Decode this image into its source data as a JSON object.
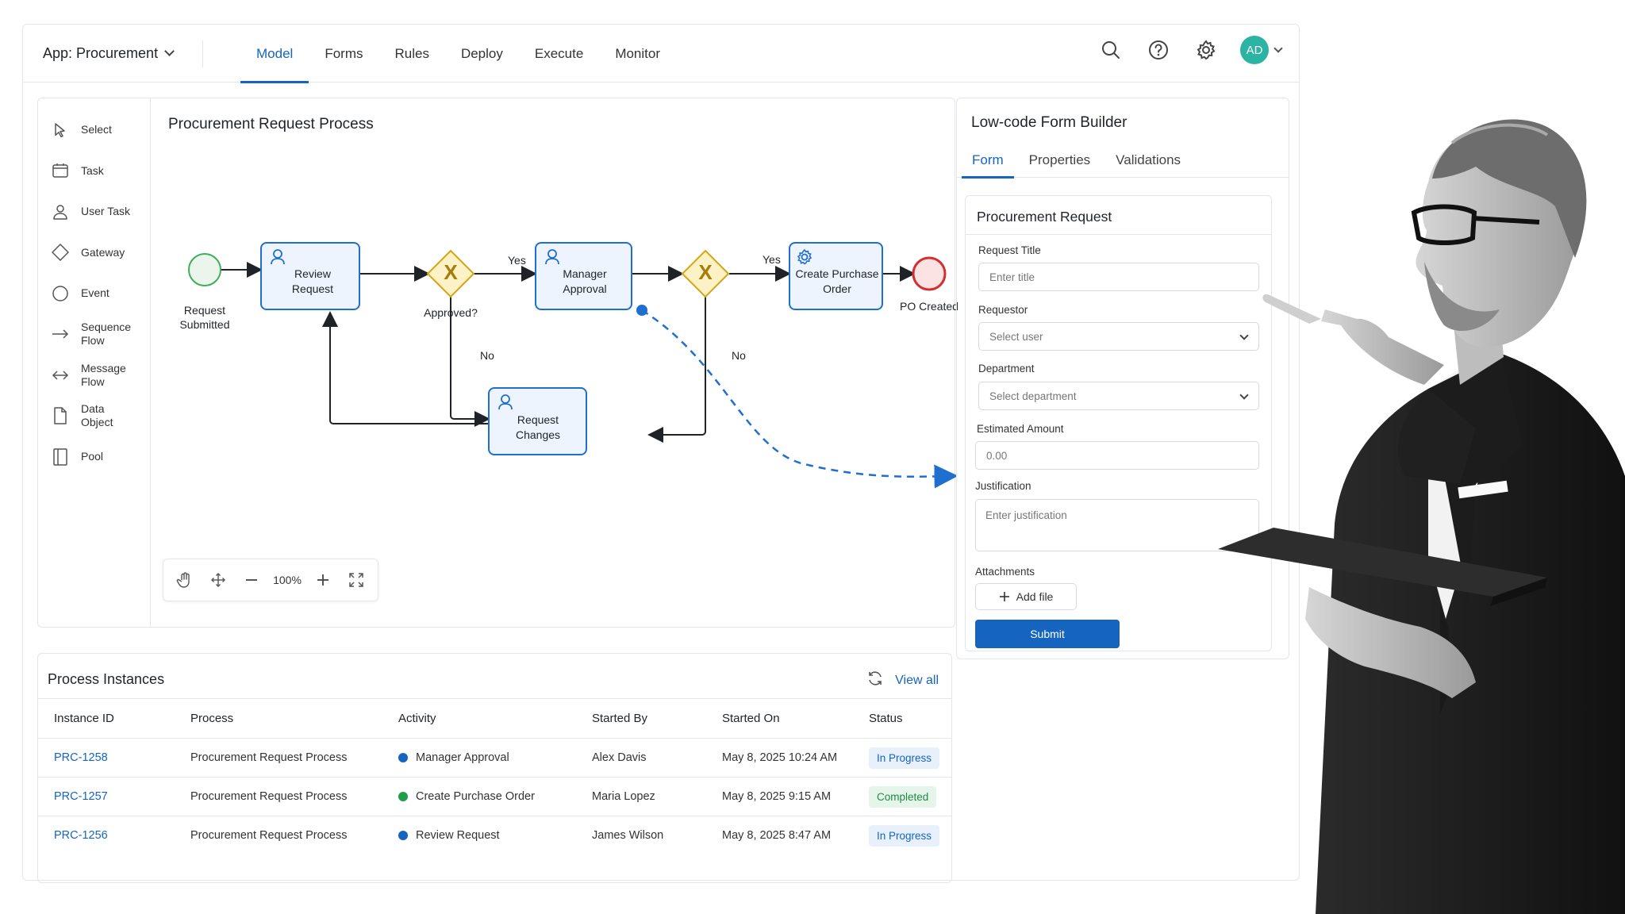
{
  "header": {
    "app_title": "App: Procurement",
    "nav": [
      "Model",
      "Forms",
      "Rules",
      "Deploy",
      "Execute",
      "Monitor"
    ],
    "active_nav": "Model",
    "avatar_initials": "AD",
    "icons": [
      "search-icon",
      "help-icon",
      "gear-icon"
    ]
  },
  "palette": {
    "items": [
      {
        "label": "Select",
        "icon": "cursor-icon"
      },
      {
        "label": "Task",
        "icon": "task-icon"
      },
      {
        "label": "User Task",
        "icon": "user-icon"
      },
      {
        "label": "Gateway",
        "icon": "diamond-icon"
      },
      {
        "label": "Event",
        "icon": "circle-icon"
      },
      {
        "label": "Sequence Flow",
        "icon": "arrow-right-icon"
      },
      {
        "label": "Message Flow",
        "icon": "arrow-both-icon"
      },
      {
        "label": "Data Object",
        "icon": "document-icon"
      },
      {
        "label": "Pool",
        "icon": "pool-icon"
      }
    ]
  },
  "canvas": {
    "title": "Procurement Request Process",
    "nodes": {
      "start": "Request Submitted",
      "review": "Review Request",
      "gateway1": "Approved?",
      "manager": "Manager Approval",
      "create_po": "Create Purchase Order",
      "end": "PO Created",
      "changes": "Request Changes"
    },
    "edge_labels": {
      "yes1": "Yes",
      "yes2": "Yes",
      "no1": "No",
      "no2": "No"
    },
    "gateway_mark": "X",
    "zoom": "100%"
  },
  "form_builder": {
    "title": "Low-code Form Builder",
    "tabs": [
      "Form",
      "Properties",
      "Validations"
    ],
    "active_tab": "Form",
    "form_title": "Procurement Request",
    "fields": {
      "title_label": "Request Title",
      "title_placeholder": "Enter title",
      "requestor_label": "Requestor",
      "requestor_placeholder": "Select user",
      "department_label": "Department",
      "department_placeholder": "Select department",
      "amount_label": "Estimated Amount",
      "amount_placeholder": "0.00",
      "justification_label": "Justification",
      "justification_placeholder": "Enter justification",
      "attachments_label": "Attachments"
    },
    "add_file": "Add file",
    "submit": "Submit"
  },
  "instances": {
    "title": "Process Instances",
    "view_all": "View all",
    "columns": [
      "Instance ID",
      "Process",
      "Activity",
      "Started By",
      "Started On",
      "Status"
    ],
    "rows": [
      {
        "id": "PRC-1258",
        "process": "Procurement Request Process",
        "activity": "Manager Approval",
        "activity_color": "#1565c0",
        "started_by": "Alex Davis",
        "started_on": "May 8, 2025 10:24 AM",
        "status": "In Progress",
        "status_bg": "#e8f0fb",
        "status_fg": "#1565c0"
      },
      {
        "id": "PRC-1257",
        "process": "Procurement Request Process",
        "activity": "Create Purchase Order",
        "activity_color": "#1e9e4a",
        "started_by": "Maria Lopez",
        "started_on": "May 8, 2025 9:15 AM",
        "status": "Completed",
        "status_bg": "#e6f5ea",
        "status_fg": "#1e8a43"
      },
      {
        "id": "PRC-1256",
        "process": "Procurement Request Process",
        "activity": "Review Request",
        "activity_color": "#1565c0",
        "started_by": "James Wilson",
        "started_on": "May 8, 2025 8:47 AM",
        "status": "In Progress",
        "status_bg": "#e8f0fb",
        "status_fg": "#1565c0"
      }
    ]
  },
  "colors": {
    "accent": "#1565c0",
    "task_fill": "#eef4fd",
    "gateway": "#f0c93a",
    "start_event": "#3fae5a",
    "end_event": "#d32f2f"
  }
}
